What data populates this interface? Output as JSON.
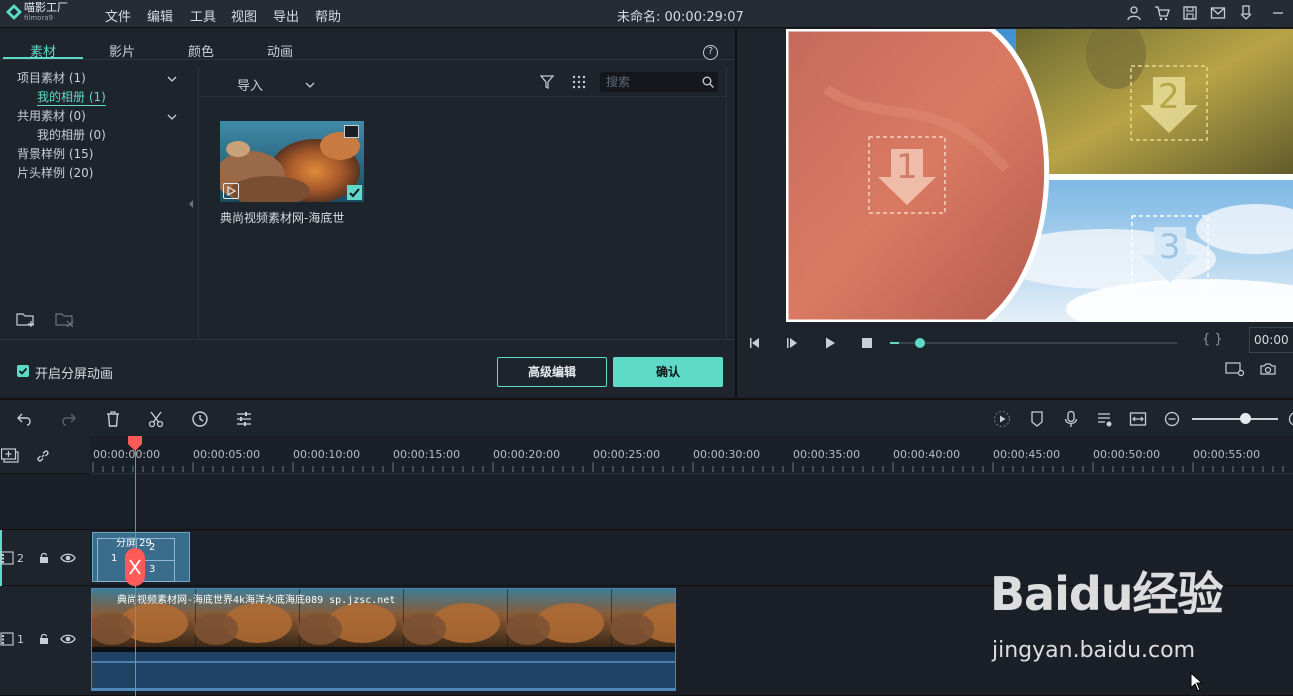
{
  "app": {
    "logo_name": "喵影工厂",
    "logo_sub": "filmora9",
    "window_title": "未命名: 00:00:29:07"
  },
  "menu": [
    "文件",
    "编辑",
    "工具",
    "视图",
    "导出",
    "帮助"
  ],
  "titlebar_icons": [
    "account-icon",
    "cart-icon",
    "save-icon",
    "mail-icon",
    "download-icon",
    "minimize-icon"
  ],
  "library": {
    "tabs": [
      "素材",
      "影片",
      "颜色",
      "动画"
    ],
    "active_tab": "素材",
    "help": "?",
    "tree": [
      {
        "label": "项目素材 (1)",
        "expandable": true
      },
      {
        "label": "我的相册 (1)",
        "selected": true
      },
      {
        "label": "共用素材 (0)",
        "expandable": true
      },
      {
        "label": "我的相册 (0)"
      },
      {
        "label": "背景样例 (15)"
      },
      {
        "label": "片头样例 (20)"
      }
    ],
    "import_label": "导入",
    "search_placeholder": "搜索",
    "media": [
      {
        "title": "典尚视频素材网-海底世"
      }
    ],
    "enable_split_animation": "开启分屏动画",
    "enable_split_checked": true,
    "advanced_edit_button": "高级编辑",
    "confirm_button": "确认"
  },
  "preview": {
    "zone_numbers": [
      "1",
      "2",
      "3"
    ],
    "timecode": "00:00",
    "progress": 0.03,
    "braces": "{   }"
  },
  "timeline": {
    "ruler_labels": [
      "00:00:00:00",
      "00:00:05:00",
      "00:00:10:00",
      "00:00:15:00",
      "00:00:20:00",
      "00:00:25:00",
      "00:00:30:00",
      "00:00:35:00",
      "00:00:40:00",
      "00:00:45:00",
      "00:00:50:00",
      "00:00:55:00"
    ],
    "tracks": [
      {
        "number": "2"
      },
      {
        "number": "1"
      }
    ],
    "split_clip_label": "分屏 29",
    "split_cells": [
      "1",
      "2",
      "3"
    ],
    "main_clip_label": "典尚视频素材网-海底世界4k海洋水底海底089 sp.jzsc.net",
    "zoom_level": 0.62
  },
  "watermark": {
    "big": "Baidu经验",
    "small": "jingyan.baidu.com"
  },
  "colors": {
    "accent": "#5fdac8",
    "playhead": "#ff5a5a"
  }
}
